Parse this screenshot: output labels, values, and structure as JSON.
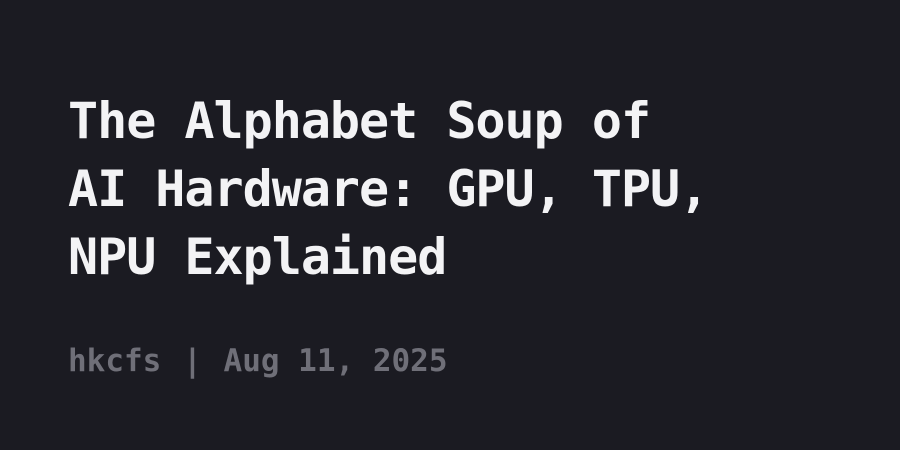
{
  "post": {
    "title_lines": [
      "The Alphabet Soup of",
      "AI Hardware: GPU, TPU,",
      "NPU Explained"
    ],
    "author": "hkcfs",
    "separator": "|",
    "date": "Aug 11, 2025"
  },
  "colors": {
    "background": "#1b1b22",
    "title": "#f3f3f5",
    "meta": "#6f6f78"
  }
}
